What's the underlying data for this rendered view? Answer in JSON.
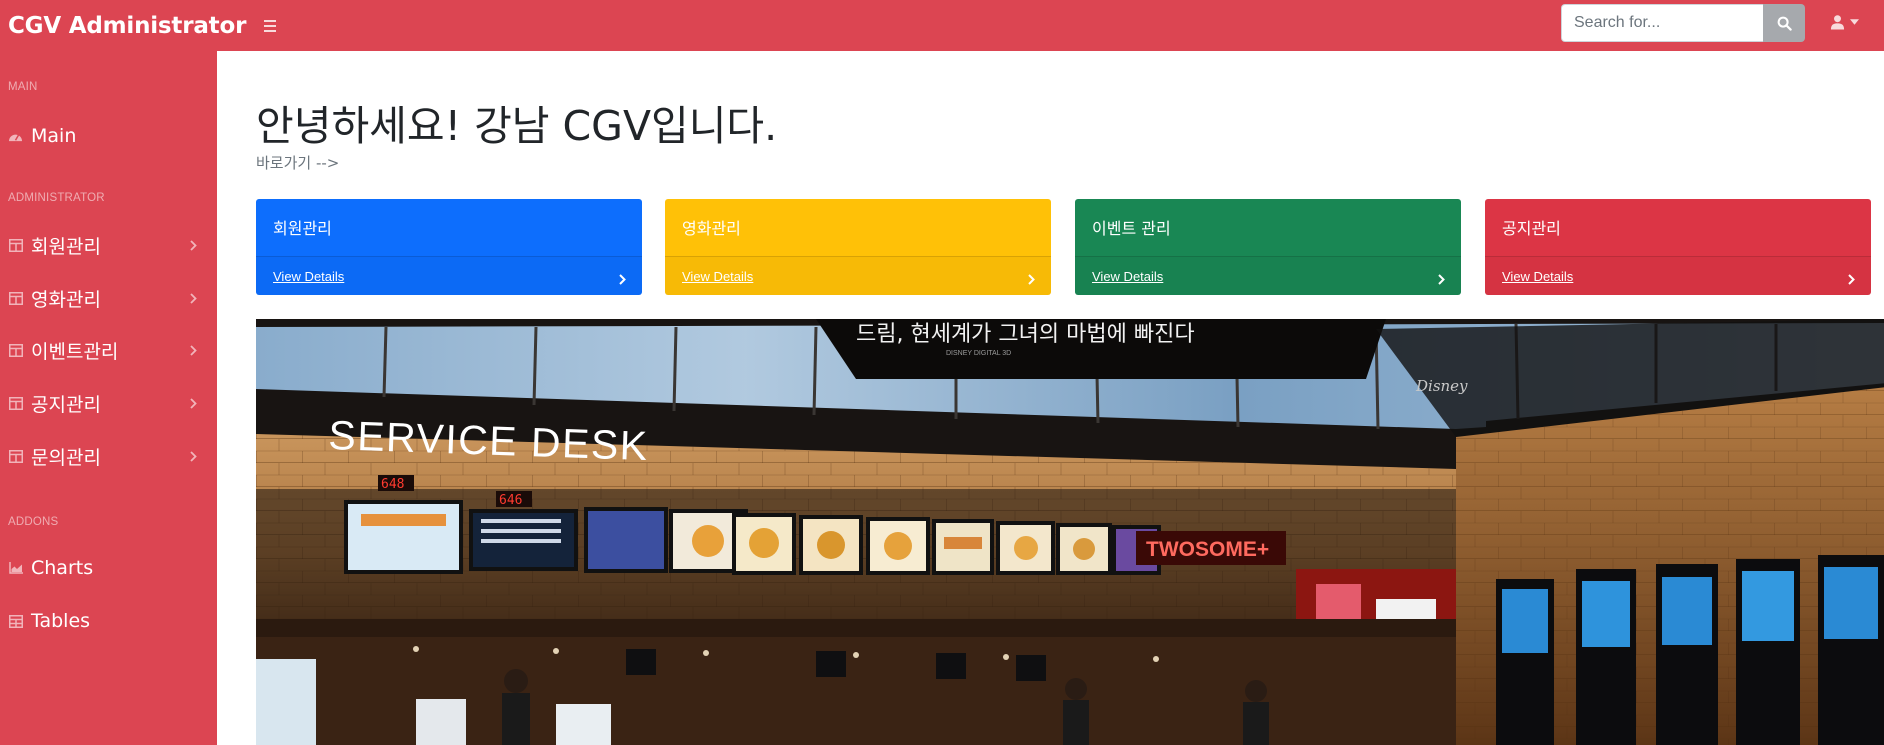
{
  "navbar": {
    "brand": "CGV Administrator",
    "search_placeholder": "Search for...",
    "icons": [
      "menu-toggle-icon",
      "search-icon",
      "user-icon",
      "caret-down-icon"
    ],
    "accent_color": "#dc4552"
  },
  "sidebar": {
    "sections": [
      {
        "heading": "MAIN",
        "items": [
          {
            "label": "Main",
            "icon": "dashboard-icon",
            "has_chevron": false
          }
        ]
      },
      {
        "heading": "ADMINISTRATOR",
        "items": [
          {
            "label": "회원관리",
            "icon": "table-icon",
            "has_chevron": true
          },
          {
            "label": "영화관리",
            "icon": "table-icon",
            "has_chevron": true
          },
          {
            "label": "이벤트관리",
            "icon": "table-icon",
            "has_chevron": true
          },
          {
            "label": "공지관리",
            "icon": "table-icon",
            "has_chevron": true
          },
          {
            "label": "문의관리",
            "icon": "table-icon",
            "has_chevron": true
          }
        ]
      },
      {
        "heading": "ADDONS",
        "items": [
          {
            "label": "Charts",
            "icon": "chart-area-icon",
            "has_chevron": false
          },
          {
            "label": "Tables",
            "icon": "table-icon",
            "has_chevron": false
          }
        ]
      }
    ]
  },
  "main": {
    "title": "안녕하세요! 강남 CGV입니다.",
    "breadcrumb": "바로가기 -->",
    "cards": [
      {
        "title": "회원관리",
        "link": "View Details",
        "color": "#0d6efd"
      },
      {
        "title": "영화관리",
        "link": "View Details",
        "color": "#ffc107"
      },
      {
        "title": "이벤트 관리",
        "link": "View Details",
        "color": "#198754"
      },
      {
        "title": "공지관리",
        "link": "View Details",
        "color": "#dc3545"
      }
    ],
    "hero": {
      "signs": {
        "service_desk": "SERVICE DESK",
        "twosome": "TWOSOME+",
        "banner": "드림, 현세계가 그녀의 마법에 빠진다",
        "banner_small": "DISNEY DIGITAL 3D",
        "disney": "Disney",
        "counter_a": "648",
        "counter_b": "646"
      }
    }
  }
}
